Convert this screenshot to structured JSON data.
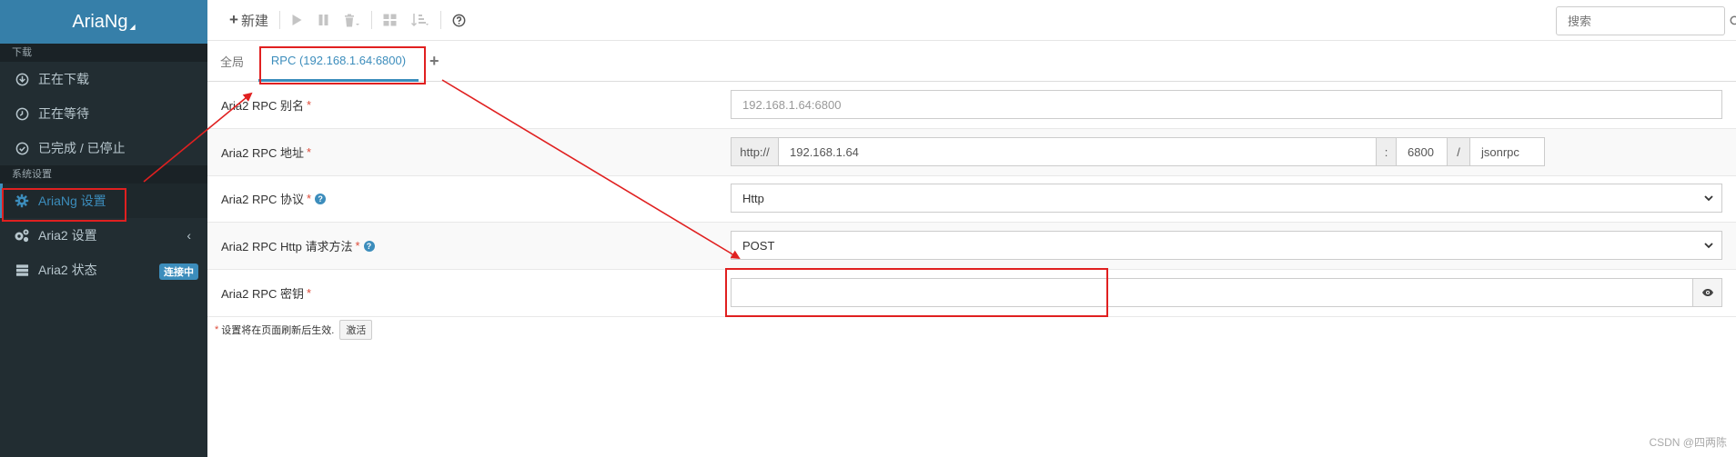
{
  "sidebar": {
    "logo": "AriaNg",
    "downloads_header": "下载",
    "downloads": [
      {
        "label": "正在下载",
        "icon": "download-circle-icon"
      },
      {
        "label": "正在等待",
        "icon": "clock-icon"
      },
      {
        "label": "已完成 / 已停止",
        "icon": "check-circle-icon"
      }
    ],
    "settings_header": "系统设置",
    "settings": [
      {
        "label": "AriaNg 设置",
        "icon": "gear-icon"
      },
      {
        "label": "Aria2 设置",
        "icon": "gears-icon"
      },
      {
        "label": "Aria2 状态",
        "icon": "server-icon",
        "badge": "连接中"
      }
    ]
  },
  "toolbar": {
    "new_label": "新建",
    "search_placeholder": "搜索"
  },
  "tabs": {
    "global": "全局",
    "rpc": "RPC (192.168.1.64:6800)",
    "add": "+"
  },
  "form": {
    "alias": {
      "label": "Aria2 RPC 别名",
      "placeholder": "192.168.1.64:6800"
    },
    "address": {
      "label": "Aria2 RPC 地址",
      "scheme": "http://",
      "host": "192.168.1.64",
      "colon": ":",
      "port": "6800",
      "slash": "/",
      "path": "jsonrpc"
    },
    "protocol": {
      "label": "Aria2 RPC 协议",
      "value": "Http"
    },
    "method": {
      "label": "Aria2 RPC Http 请求方法",
      "value": "POST"
    },
    "secret": {
      "label": "Aria2 RPC 密钥",
      "value": ""
    },
    "required_mark": "*"
  },
  "footnote": {
    "mark": "*",
    "text": "设置将在页面刷新后生效.",
    "button": "激活"
  },
  "watermark": "CSDN @四两陈",
  "colors": {
    "sidebar_bg": "#222d32",
    "logo_bg": "#367fa9",
    "accent": "#3c8dbc",
    "annotation": "#e02020"
  }
}
